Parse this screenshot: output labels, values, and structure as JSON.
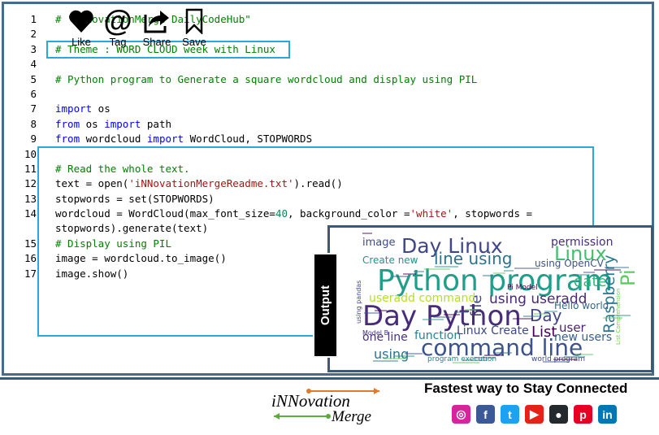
{
  "code": {
    "lines": [
      {
        "n": "1",
        "tokens": [
          {
            "t": "# \"iNNovationMerge DailyCodeHub\"",
            "c": "cm"
          }
        ]
      },
      {
        "n": "2",
        "tokens": []
      },
      {
        "n": "3",
        "tokens": [
          {
            "t": "# Theme : WORD CLOUD week with Linux",
            "c": "cm"
          }
        ]
      },
      {
        "n": "4",
        "tokens": []
      },
      {
        "n": "5",
        "tokens": [
          {
            "t": "# Python program to Generate a square wordcloud and display using PIL",
            "c": "cm"
          }
        ]
      },
      {
        "n": "6",
        "tokens": []
      },
      {
        "n": "7",
        "tokens": [
          {
            "t": "import",
            "c": "kw"
          },
          {
            "t": " os",
            "c": ""
          }
        ]
      },
      {
        "n": "8",
        "tokens": [
          {
            "t": "from",
            "c": "kw"
          },
          {
            "t": " os ",
            "c": ""
          },
          {
            "t": "import",
            "c": "kw"
          },
          {
            "t": " path",
            "c": ""
          }
        ]
      },
      {
        "n": "9",
        "tokens": [
          {
            "t": "from",
            "c": "kw"
          },
          {
            "t": " wordcloud ",
            "c": ""
          },
          {
            "t": "import",
            "c": "kw"
          },
          {
            "t": " WordCloud, STOPWORDS",
            "c": ""
          }
        ]
      },
      {
        "n": "10",
        "tokens": []
      },
      {
        "n": "11",
        "tokens": [
          {
            "t": "# Read the whole text.",
            "c": "cm"
          }
        ]
      },
      {
        "n": "12",
        "tokens": [
          {
            "t": "text = open(",
            "c": ""
          },
          {
            "t": "'iNNovationMergeReadme.txt'",
            "c": "st"
          },
          {
            "t": ").read()",
            "c": ""
          }
        ]
      },
      {
        "n": "13",
        "tokens": [
          {
            "t": "stopwords = set(STOPWORDS)",
            "c": ""
          }
        ]
      },
      {
        "n": "14",
        "tokens": [
          {
            "t": "wordcloud = WordCloud(max_font_size=",
            "c": ""
          },
          {
            "t": "40",
            "c": "nm"
          },
          {
            "t": ", background_color =",
            "c": ""
          },
          {
            "t": "'white'",
            "c": "st"
          },
          {
            "t": ", stopwords =",
            "c": ""
          }
        ]
      },
      {
        "n": "",
        "tokens": [
          {
            "t": "stopwords).generate(text)",
            "c": ""
          }
        ]
      },
      {
        "n": "15",
        "tokens": [
          {
            "t": "# Display using PIL",
            "c": "cm"
          }
        ]
      },
      {
        "n": "16",
        "tokens": [
          {
            "t": "image = wordcloud.to_image()",
            "c": ""
          }
        ]
      },
      {
        "n": "17",
        "tokens": [
          {
            "t": "image.show()",
            "c": ""
          }
        ]
      }
    ]
  },
  "output_label": "Output",
  "wordcloud": {
    "words": [
      {
        "w": "image",
        "c": "#3e4a89"
      },
      {
        "w": "Day Linux",
        "c": "#404688"
      },
      {
        "w": "permission",
        "c": "#472d7b"
      },
      {
        "w": "Linux",
        "c": "#44bf70"
      },
      {
        "w": "line using",
        "c": "#2c728e"
      },
      {
        "w": "Create new",
        "c": "#21918c"
      },
      {
        "w": "using OpenCV",
        "c": "#3b528b"
      },
      {
        "w": "Python program",
        "c": "#1f9e89"
      },
      {
        "w": "date",
        "c": "#35b779"
      },
      {
        "w": "file",
        "c": "#414487"
      },
      {
        "w": "Pi",
        "c": "#5ec962"
      },
      {
        "w": "useradd command",
        "c": "#b5de2b"
      },
      {
        "w": "using useradd",
        "c": "#482878"
      },
      {
        "w": "Raspberry",
        "c": "#2a788e"
      },
      {
        "w": "Hello world",
        "c": "#31688e"
      },
      {
        "w": "Day Python",
        "c": "#472c7a"
      },
      {
        "w": "Day",
        "c": "#414487"
      },
      {
        "w": "one line",
        "c": "#46327e"
      },
      {
        "w": "function",
        "c": "#26828e"
      },
      {
        "w": "Linux Create",
        "c": "#3e4989"
      },
      {
        "w": "List",
        "c": "#440154"
      },
      {
        "w": "user",
        "c": "#481f70"
      },
      {
        "w": "new users",
        "c": "#355f8d"
      },
      {
        "w": "command line",
        "c": "#3b528b"
      },
      {
        "w": "using",
        "c": "#2c728e"
      },
      {
        "w": "Model B",
        "c": "#46337e"
      },
      {
        "w": "Pi Model",
        "c": "#440154"
      },
      {
        "w": "world program",
        "c": "#3e4a89"
      },
      {
        "w": "program execution",
        "c": "#26828e"
      },
      {
        "w": "List Comprehension",
        "c": "#73d056"
      },
      {
        "w": "using pandas",
        "c": "#404688"
      }
    ]
  },
  "actions": [
    {
      "label": "Like",
      "icon": "heart-icon"
    },
    {
      "label": "Tag",
      "icon": "at-icon"
    },
    {
      "label": "Share",
      "icon": "share-icon"
    },
    {
      "label": "Save",
      "icon": "bookmark-icon"
    }
  ],
  "brand": {
    "line1": "iNNovation",
    "line2": "Merge"
  },
  "tagline": "Fastest way to Stay Connected",
  "social": [
    {
      "name": "instagram-icon",
      "glyph": "◎",
      "color": "#d6249f"
    },
    {
      "name": "facebook-icon",
      "glyph": "f",
      "color": "#3b5998"
    },
    {
      "name": "twitter-icon",
      "glyph": "t",
      "color": "#1da1f2"
    },
    {
      "name": "youtube-icon",
      "glyph": "▶",
      "color": "#e62117"
    },
    {
      "name": "github-icon",
      "glyph": "●",
      "color": "#24292e"
    },
    {
      "name": "pinterest-icon",
      "glyph": "p",
      "color": "#e60023"
    },
    {
      "name": "linkedin-icon",
      "glyph": "in",
      "color": "#0077b5"
    }
  ]
}
